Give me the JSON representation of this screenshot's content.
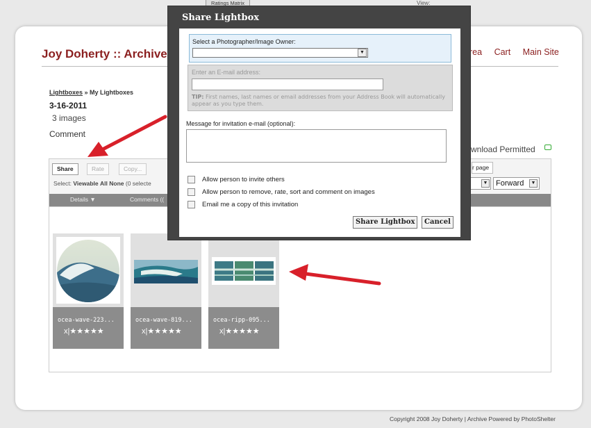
{
  "site": {
    "title": "Joy Doherty :: Archive",
    "nav": [
      "rea",
      "Cart",
      "Main Site"
    ],
    "ratings_tab": "Ratings Matrix",
    "view_label": "View:"
  },
  "lightbox": {
    "breadcrumb_link": "Lightboxes",
    "breadcrumb_rest": " » My Lightboxes",
    "name": "3-16-2011",
    "count": "3 images",
    "comment": "Comment",
    "download": "wnload Permitted"
  },
  "toolbar": {
    "share": "Share",
    "rate": "Rate",
    "copy": "Copy...",
    "select_label": "Select:",
    "select_viewable": "Viewable",
    "select_all": "All",
    "select_none": "None",
    "select_count": "(0 selecte",
    "per_page": "r page",
    "sort_direction": "Forward",
    "col_details": "Details ▼",
    "col_comments": "Comments (("
  },
  "thumbnails": [
    {
      "filename": "ocea-wave-223...",
      "rating": "x|★★★★★"
    },
    {
      "filename": "ocea-wave-819...",
      "rating": "x|★★★★★"
    },
    {
      "filename": "ocea-ripp-095...",
      "rating": "x|★★★★★"
    }
  ],
  "copyright": "Copyright 2008 Joy Doherty | Archive Powered by PhotoShelter",
  "dialog": {
    "title": "Share Lightbox",
    "owner_label": "Select a Photographer/Image Owner:",
    "owner_value": "",
    "email_label": "Enter an E-mail address:",
    "email_value": "",
    "tip_label": "TIP:",
    "tip_text": " First names, last names or email addresses from your Address Book will automatically appear as you type them.",
    "message_label": "Message for invitation e-mail (optional):",
    "message_value": "",
    "options": [
      {
        "label": "Allow person to invite others",
        "checked": false
      },
      {
        "label": "Allow person to remove, rate, sort and comment on images",
        "checked": false
      },
      {
        "label": "Email me a copy of this invitation",
        "checked": false
      }
    ],
    "share_button": "Share Lightbox",
    "cancel_button": "Cancel"
  },
  "colors": {
    "title_red": "#8b1f1f",
    "dialog_frame": "#444444",
    "arrow_red": "#d8202a"
  }
}
